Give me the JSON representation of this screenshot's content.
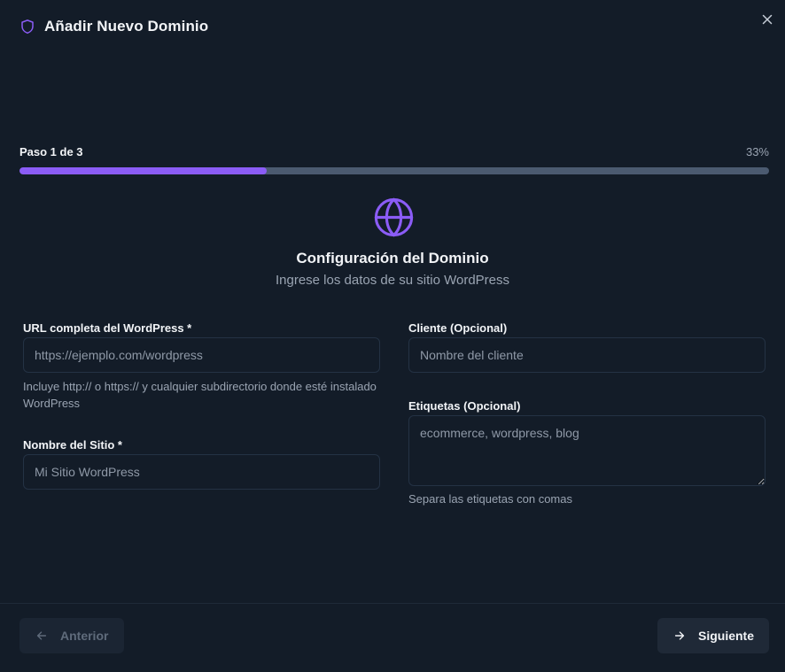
{
  "header": {
    "title": "Añadir Nuevo Dominio",
    "icon": "shield-icon"
  },
  "close": {
    "icon": "close-icon"
  },
  "progress": {
    "step_label": "Paso 1 de 3",
    "percent_label": "33%",
    "value": 0.33
  },
  "section": {
    "icon": "globe-icon",
    "title": "Configuración del Dominio",
    "subtitle": "Ingrese los datos de su sitio WordPress"
  },
  "form": {
    "url": {
      "label": "URL completa del WordPress *",
      "placeholder": "https://ejemplo.com/wordpress",
      "value": "",
      "help": "Incluye http:// o https:// y cualquier subdirectorio donde esté instalado WordPress"
    },
    "site_name": {
      "label": "Nombre del Sitio *",
      "placeholder": "Mi Sitio WordPress",
      "value": ""
    },
    "client": {
      "label": "Cliente (Opcional)",
      "placeholder": "Nombre del cliente",
      "value": ""
    },
    "tags": {
      "label": "Etiquetas (Opcional)",
      "placeholder": "ecommerce, wordpress, blog",
      "value": "",
      "help": "Separa las etiquetas con comas"
    }
  },
  "footer": {
    "prev_label": "Anterior",
    "next_label": "Siguiente"
  },
  "colors": {
    "accent": "#8b5cf6",
    "background": "#131c28",
    "track": "#4b5a70"
  }
}
